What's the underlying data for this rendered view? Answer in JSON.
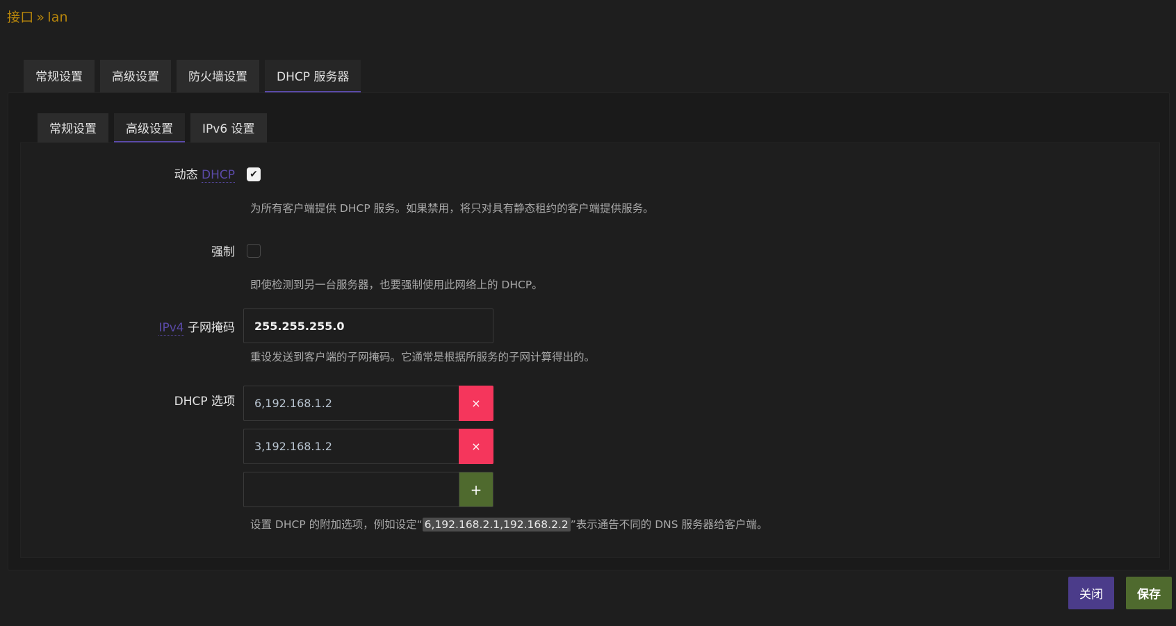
{
  "breadcrumb": {
    "part1": "接口",
    "sep": "»",
    "part2": "lan"
  },
  "main_tabs": [
    {
      "label": "常规设置"
    },
    {
      "label": "高级设置"
    },
    {
      "label": "防火墙设置"
    },
    {
      "label": "DHCP 服务器"
    }
  ],
  "sub_tabs": [
    {
      "label": "常规设置"
    },
    {
      "label": "高级设置"
    },
    {
      "label": "IPv6 设置"
    }
  ],
  "fields": {
    "dynamic_dhcp": {
      "label_prefix": "动态",
      "label_abbr": "DHCP",
      "checked": true,
      "help": "为所有客户端提供 DHCP 服务。如果禁用，将只对具有静态租约的客户端提供服务。"
    },
    "force": {
      "label": "强制",
      "checked": false,
      "help": "即使检测到另一台服务器，也要强制使用此网络上的 DHCP。"
    },
    "netmask": {
      "label_abbr": "IPv4",
      "label_suffix": "子网掩码",
      "value": "255.255.255.0",
      "help": "重设发送到客户端的子网掩码。它通常是根据所服务的子网计算得出的。"
    },
    "dhcp_options": {
      "label": "DHCP 选项",
      "values": [
        "6,192.168.1.2",
        "3,192.168.1.2"
      ],
      "new_value": "",
      "help_prefix": "设置 DHCP 的附加选项，例如设定“",
      "help_code": "6,192.168.2.1,192.168.2.2",
      "help_suffix": "”表示通告不同的 DNS 服务器给客户端。"
    }
  },
  "icons": {
    "check": "✔",
    "remove": "×",
    "add": "+"
  },
  "buttons": {
    "close": "关闭",
    "save": "保存"
  },
  "colors": {
    "accent": "#5a4aa8",
    "danger": "#f5365c",
    "success": "#4f6a2e",
    "title": "#b8860b"
  }
}
